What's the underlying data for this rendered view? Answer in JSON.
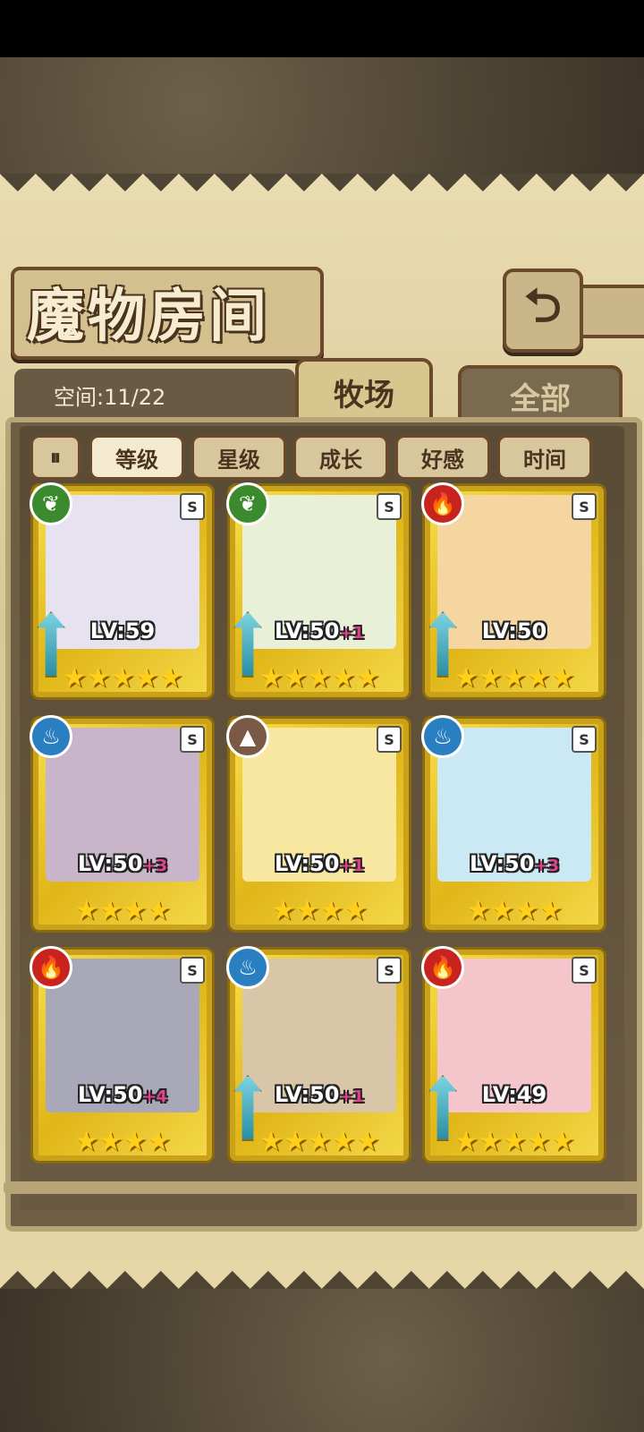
{
  "title": "魔物房间",
  "back_icon": "⮌",
  "space_label": "空间:11/22",
  "tabs": {
    "farm": "牧场",
    "all": "全部"
  },
  "filters": [
    "等级",
    "星级",
    "成长",
    "好感",
    "时间"
  ],
  "cards": [
    {
      "element": "leaf",
      "element_glyph": "❦",
      "element_color": "#3b8a2e",
      "level": "LV:59",
      "bonus": "",
      "stars": "★★★★★",
      "portrait_bg": "#e6e2f0"
    },
    {
      "element": "leaf",
      "element_glyph": "❦",
      "element_color": "#3b8a2e",
      "level": "LV:50",
      "bonus": "+1",
      "stars": "★★★★★",
      "portrait_bg": "#e9f0d8"
    },
    {
      "element": "fire",
      "element_glyph": "🔥",
      "element_color": "#c8231e",
      "level": "LV:50",
      "bonus": "",
      "stars": "★★★★★",
      "portrait_bg": "#f6d6a0"
    },
    {
      "element": "water",
      "element_glyph": "♨",
      "element_color": "#2a7fc0",
      "level": "LV:50",
      "bonus": "+3",
      "stars": "★★★★",
      "portrait_bg": "#c9b5c9"
    },
    {
      "element": "earth",
      "element_glyph": "▲",
      "element_color": "#7a5a44",
      "level": "LV:50",
      "bonus": "+1",
      "stars": "★★★★",
      "portrait_bg": "#f7e7a0"
    },
    {
      "element": "water",
      "element_glyph": "♨",
      "element_color": "#2a7fc0",
      "level": "LV:50",
      "bonus": "+3",
      "stars": "★★★★",
      "portrait_bg": "#cbe9f4"
    },
    {
      "element": "fire",
      "element_glyph": "🔥",
      "element_color": "#c8231e",
      "level": "LV:50",
      "bonus": "+4",
      "stars": "★★★★",
      "portrait_bg": "#a8a8b8"
    },
    {
      "element": "water",
      "element_glyph": "♨",
      "element_color": "#2a7fc0",
      "level": "LV:50",
      "bonus": "+1",
      "stars": "★★★★★",
      "portrait_bg": "#d9c6a8"
    },
    {
      "element": "fire",
      "element_glyph": "🔥",
      "element_color": "#c8231e",
      "level": "LV:49",
      "bonus": "",
      "stars": "★★★★★",
      "portrait_bg": "#f4c6cc"
    }
  ],
  "rank_glyph": "S"
}
